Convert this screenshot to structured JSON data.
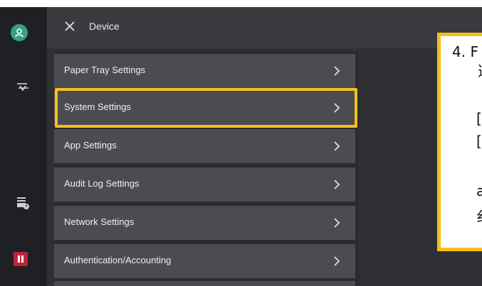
{
  "header": {
    "title": "Device"
  },
  "menu": {
    "items": [
      {
        "label": "Paper Tray Settings"
      },
      {
        "label": "System Settings"
      },
      {
        "label": "App Settings"
      },
      {
        "label": "Audit Log Settings"
      },
      {
        "label": "Network Settings"
      },
      {
        "label": "Authentication/Accounting"
      }
    ]
  },
  "instruction": {
    "line1": "4. F",
    "line2": "选",
    "line3": "[",
    "line4": "[",
    "line5": "a",
    "line6": "纟"
  },
  "icons": {
    "avatar": "user-icon",
    "sidebar_swap": "swap-arrows-icon",
    "sidebar_job": "job-status-icon",
    "sidebar_stop": "stop-icon",
    "close": "close-icon",
    "chevron": "chevron-right-icon"
  },
  "colors": {
    "highlight": "#f5c01a",
    "avatar": "#37a082",
    "stop": "#c0233a"
  }
}
